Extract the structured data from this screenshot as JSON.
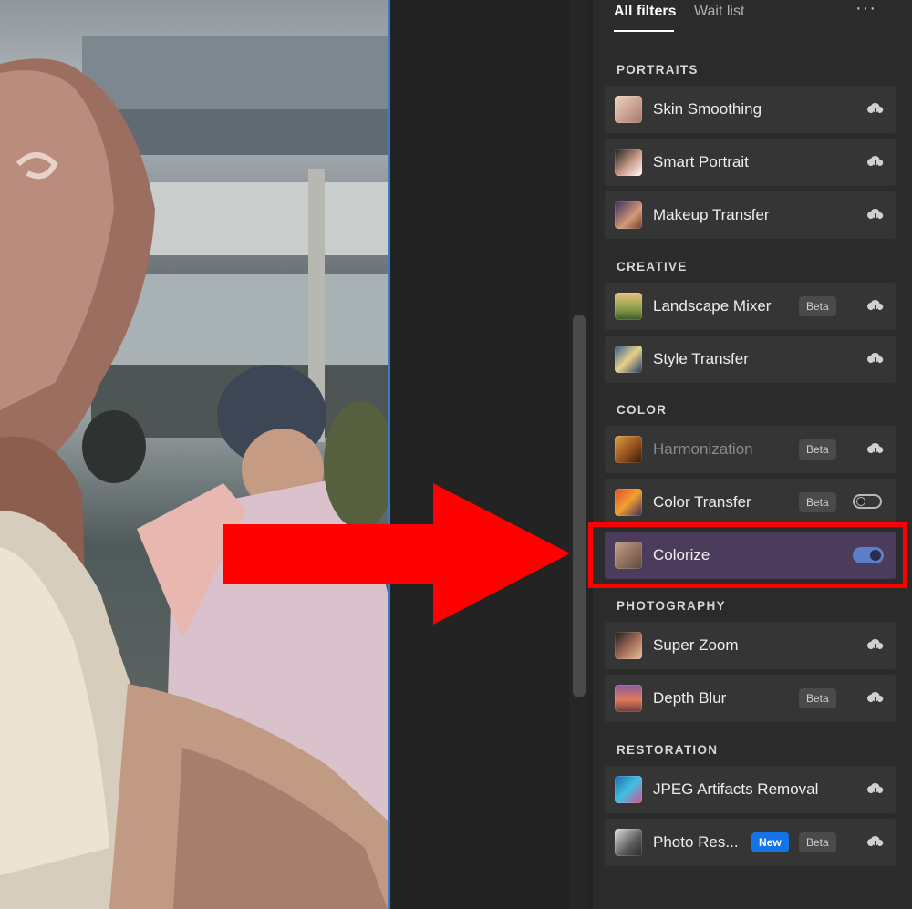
{
  "tabs": [
    {
      "label": "All filters",
      "active": true
    },
    {
      "label": "Wait list",
      "active": false
    }
  ],
  "more_menu_label": "···",
  "sections": [
    {
      "title": "PORTRAITS",
      "items": [
        {
          "label": "Skin Smoothing",
          "badges": [],
          "action": "cloud-download-icon"
        },
        {
          "label": "Smart Portrait",
          "badges": [],
          "action": "cloud-download-icon"
        },
        {
          "label": "Makeup Transfer",
          "badges": [],
          "action": "cloud-download-icon"
        }
      ]
    },
    {
      "title": "CREATIVE",
      "items": [
        {
          "label": "Landscape Mixer",
          "badges": [
            "Beta"
          ],
          "action": "cloud-download-icon"
        },
        {
          "label": "Style Transfer",
          "badges": [],
          "action": "cloud-download-icon"
        }
      ]
    },
    {
      "title": "COLOR",
      "items": [
        {
          "label": "Harmonization",
          "badges": [
            "Beta"
          ],
          "action": "cloud-download-icon",
          "disabled": true
        },
        {
          "label": "Color Transfer",
          "badges": [
            "Beta"
          ],
          "action": "toggle",
          "enabled": false
        },
        {
          "label": "Colorize",
          "badges": [],
          "action": "toggle",
          "enabled": true,
          "highlighted": true
        }
      ]
    },
    {
      "title": "PHOTOGRAPHY",
      "items": [
        {
          "label": "Super Zoom",
          "badges": [],
          "action": "cloud-download-icon"
        },
        {
          "label": "Depth Blur",
          "badges": [
            "Beta"
          ],
          "action": "cloud-download-icon"
        }
      ]
    },
    {
      "title": "RESTORATION",
      "items": [
        {
          "label": "JPEG Artifacts Removal",
          "badges": [],
          "action": "cloud-download-icon"
        },
        {
          "label": "Photo Res...",
          "badges": [
            "New",
            "Beta"
          ],
          "action": "cloud-download-icon"
        }
      ]
    }
  ],
  "colors": {
    "panel_bg": "#2b2b2b",
    "row_bg": "#353535",
    "row_selected_bg": "#4a3c5a",
    "toggle_on": "#5b7fc9",
    "badge_new": "#1473e6",
    "annotation_red": "#ff0000",
    "photo_border": "#3d78c7"
  }
}
